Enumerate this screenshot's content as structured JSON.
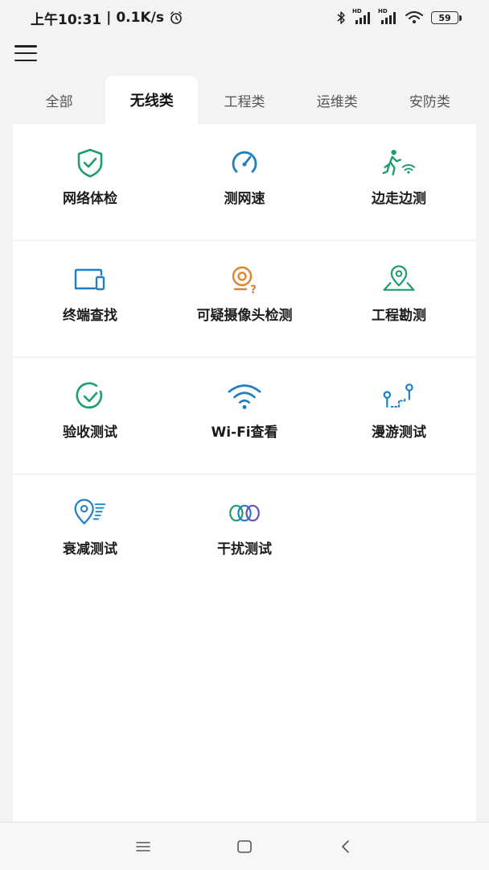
{
  "status_bar": {
    "time": "上午10:31",
    "speed": "0.1K/s",
    "signal_1_label": "HD",
    "signal_2_label": "HD",
    "battery_level": "59"
  },
  "tabs": [
    {
      "label": "全部",
      "active": false
    },
    {
      "label": "无线类",
      "active": true
    },
    {
      "label": "工程类",
      "active": false
    },
    {
      "label": "运维类",
      "active": false
    },
    {
      "label": "安防类",
      "active": false
    }
  ],
  "tools": [
    {
      "label": "网络体检",
      "icon": "shield-check-icon",
      "color": "#1f9d6b"
    },
    {
      "label": "测网速",
      "icon": "speedometer-icon",
      "color": "#1f7fc4"
    },
    {
      "label": "边走边测",
      "icon": "walking-wifi-icon",
      "color": "#1f9d6b"
    },
    {
      "label": "终端查找",
      "icon": "devices-icon",
      "color": "#1f7fc4"
    },
    {
      "label": "可疑摄像头检测",
      "icon": "camera-search-icon",
      "color": "#e0832e"
    },
    {
      "label": "工程勘测",
      "icon": "map-pin-icon",
      "color": "#1f9d6b"
    },
    {
      "label": "验收测试",
      "icon": "check-circle-icon",
      "color": "#1f9d6b"
    },
    {
      "label": "Wi-Fi查看",
      "icon": "wifi-icon",
      "color": "#1f7fc4"
    },
    {
      "label": "漫游测试",
      "icon": "roaming-icon",
      "color": "#1f7fc4"
    },
    {
      "label": "衰减测试",
      "icon": "attenuation-icon",
      "color": "#1f7fc4"
    },
    {
      "label": "干扰测试",
      "icon": "interference-rings-icon",
      "color": "#6b4fb3"
    }
  ],
  "nav_bar": {
    "buttons": [
      "menu-nav-icon",
      "home-nav-icon",
      "back-nav-icon"
    ]
  }
}
